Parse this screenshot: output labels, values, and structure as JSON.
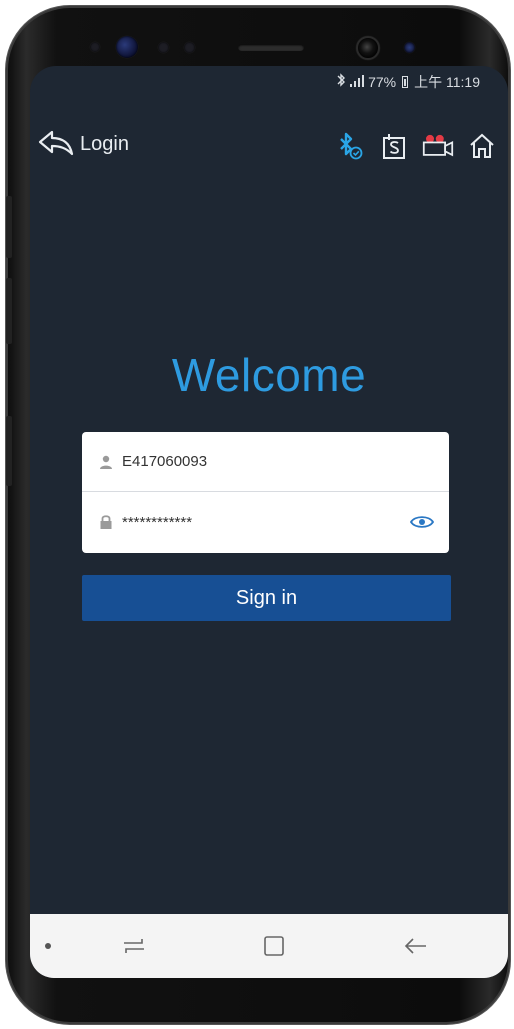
{
  "status_bar": {
    "signal": "❙❙",
    "battery_percent": "77%",
    "time": "上午 11:19"
  },
  "app_bar": {
    "back_label": "Login",
    "icons": [
      "bluetooth-connected-icon",
      "s-box-icon",
      "video-camera-icon",
      "home-icon"
    ]
  },
  "welcome_title": "Welcome",
  "login_form": {
    "username_value": "E417060093",
    "password_value": "************"
  },
  "sign_in_label": "Sign in",
  "colors": {
    "screen_bg": "#1e2733",
    "accent": "#2e9be0",
    "button": "#174f94",
    "card": "#ffffff"
  }
}
